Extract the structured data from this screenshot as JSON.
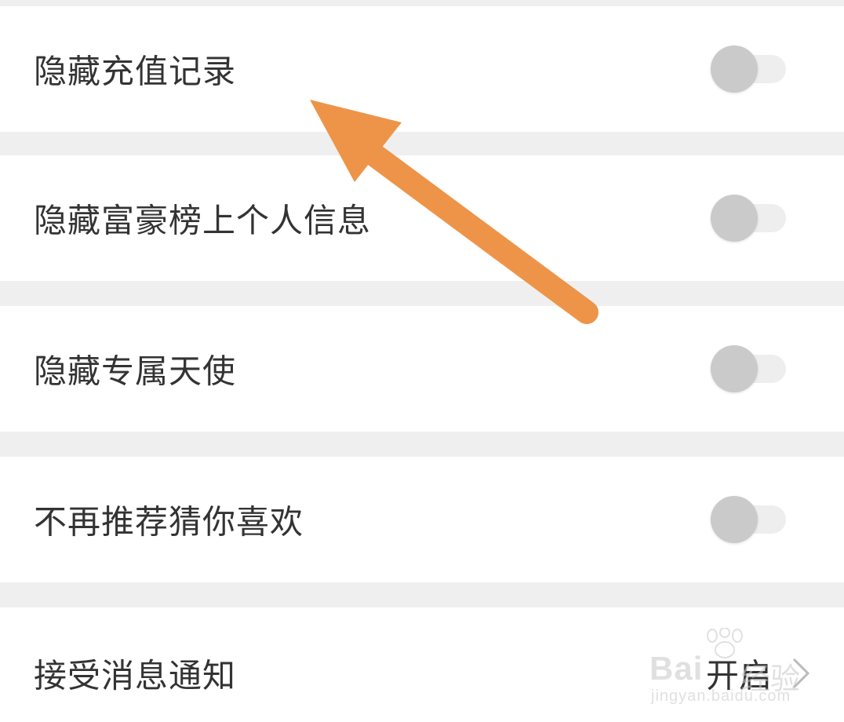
{
  "settings": {
    "items": [
      {
        "label": "隐藏充值记录",
        "type": "toggle",
        "on": false
      },
      {
        "label": "隐藏富豪榜上个人信息",
        "type": "toggle",
        "on": false
      },
      {
        "label": "隐藏专属天使",
        "type": "toggle",
        "on": false
      },
      {
        "label": "不再推荐猜你喜欢",
        "type": "toggle",
        "on": false
      },
      {
        "label": "接受消息通知",
        "type": "link",
        "value": "开启"
      }
    ]
  },
  "colors": {
    "background": "#efefef",
    "row": "#ffffff",
    "text": "#333333",
    "toggle_thumb_off": "#cacaca",
    "toggle_track_off": "#eeeeee",
    "annotation_arrow": "#ee9448"
  },
  "icons": {
    "toggle": "toggle-switch-icon",
    "chevron": "chevron-right-icon",
    "arrow": "annotation-arrow-icon"
  },
  "watermark": {
    "brand": "Bai",
    "brand_cn": "经验",
    "domain": "jingyan.baidu.com"
  }
}
